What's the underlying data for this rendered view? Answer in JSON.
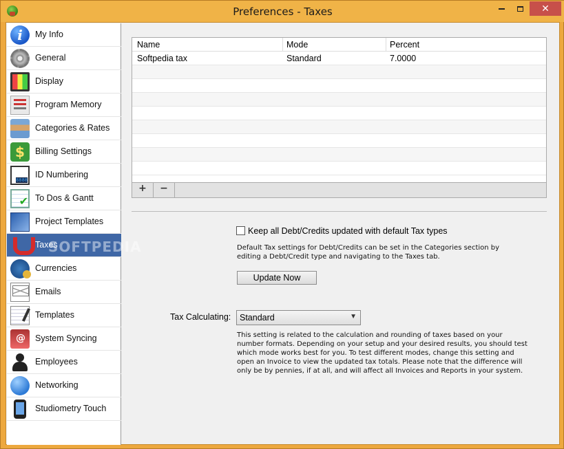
{
  "window": {
    "title": "Preferences - Taxes",
    "controls": {
      "minimize": "",
      "maximize": "",
      "close": "✕"
    }
  },
  "sidebar": {
    "items": [
      {
        "label": "My Info",
        "icon": "info-icon"
      },
      {
        "label": "General",
        "icon": "gear-icon"
      },
      {
        "label": "Display",
        "icon": "monitor-icon"
      },
      {
        "label": "Program Memory",
        "icon": "memory-icon"
      },
      {
        "label": "Categories & Rates",
        "icon": "categories-icon"
      },
      {
        "label": "Billing Settings",
        "icon": "dollar-icon"
      },
      {
        "label": "ID Numbering",
        "icon": "id-counter-icon"
      },
      {
        "label": "To Dos & Gantt",
        "icon": "checklist-icon"
      },
      {
        "label": "Project Templates",
        "icon": "blueprint-icon"
      },
      {
        "label": "Taxes",
        "icon": "magnet-icon",
        "active": true
      },
      {
        "label": "Currencies",
        "icon": "globe-coins-icon"
      },
      {
        "label": "Emails",
        "icon": "envelope-icon"
      },
      {
        "label": "Templates",
        "icon": "document-pen-icon"
      },
      {
        "label": "System Syncing",
        "icon": "address-book-icon"
      },
      {
        "label": "Employees",
        "icon": "person-icon"
      },
      {
        "label": "Networking",
        "icon": "network-globe-icon"
      },
      {
        "label": "Studiometry Touch",
        "icon": "phone-icon"
      }
    ],
    "watermark": "SOFTPEDIA"
  },
  "taxes_table": {
    "columns": [
      "Name",
      "Mode",
      "Percent"
    ],
    "rows": [
      {
        "name": "Softpedia tax",
        "mode": "Standard",
        "percent": "7.0000"
      }
    ],
    "add_label": "+",
    "remove_label": "−"
  },
  "debt_credits": {
    "checkbox_label": "Keep all Debt/Credits updated with default Tax types",
    "checked": false,
    "help": "Default Tax settings for Debt/Credits can be set in the Categories section by editing a Debt/Credit type and navigating to the Taxes tab.",
    "update_button": "Update Now"
  },
  "tax_calculating": {
    "label": "Tax Calculating:",
    "selected": "Standard",
    "help": "This setting is related to the calculation and rounding of taxes based on your number formats. Depending on your setup and your desired results, you should test which mode works best for you. To test different modes, change this setting and open an Invoice to view the updated tax totals. Please note that the difference will only be by pennies, if at all, and will affect all Invoices and Reports in your system."
  },
  "colors": {
    "window_frame": "#eda83e",
    "selection": "#3f67a6",
    "close_button": "#c7504a"
  }
}
